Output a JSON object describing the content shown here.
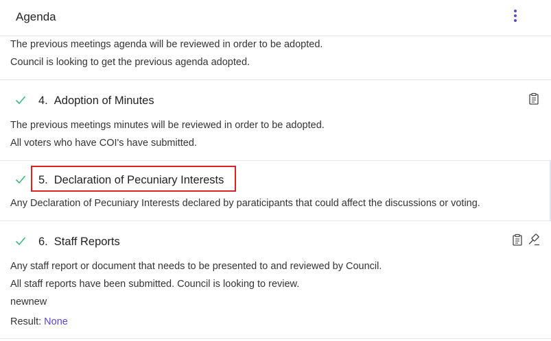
{
  "header": {
    "title": "Agenda",
    "menu_icon": "more-vertical-icon"
  },
  "item3": {
    "lines": [
      "The previous meetings agenda will be reviewed in order to be adopted.",
      "Council is looking to get the previous agenda adopted."
    ]
  },
  "item4": {
    "number": "4.",
    "title": "Adoption of Minutes",
    "status_icon": "check-icon",
    "action_icons": [
      "clipboard-icon"
    ],
    "lines": [
      "The previous meetings minutes will be reviewed in order to be adopted.",
      "All voters who have COI's have submitted."
    ]
  },
  "item5": {
    "number": "5.",
    "title": "Declaration of Pecuniary Interests",
    "status_icon": "check-icon",
    "lines": [
      "Any Declaration of Pecuniary Interests declared by paraticipants that could affect the discussions or voting."
    ]
  },
  "item6": {
    "number": "6.",
    "title": "Staff Reports",
    "status_icon": "check-icon",
    "action_icons": [
      "clipboard-icon",
      "gavel-icon"
    ],
    "lines": [
      "Any staff report or document that needs to be presented to and reviewed by Council.",
      "All staff reports have been submitted. Council is looking to review.",
      "newnew"
    ],
    "result_label": "Result:",
    "result_value": "None"
  },
  "colors": {
    "accent": "#5b47c8",
    "check": "#3cb878",
    "highlight": "#e02020"
  }
}
